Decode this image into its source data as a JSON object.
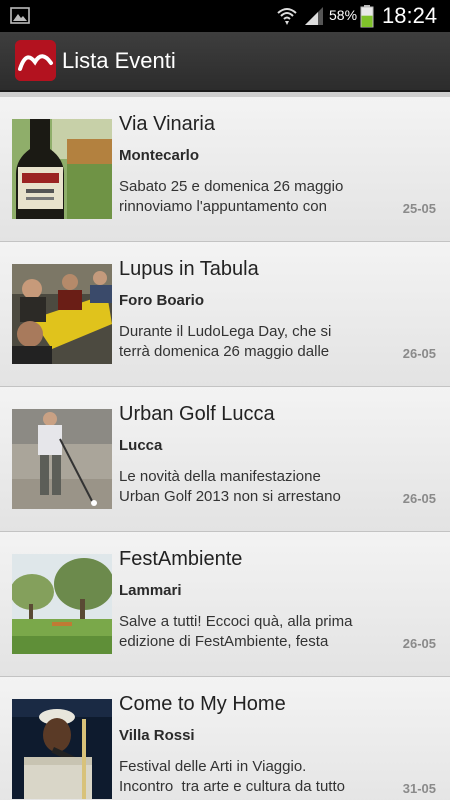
{
  "status_bar": {
    "battery_percent": "58%",
    "time": "18:24",
    "icons": [
      "gallery-icon",
      "wifi-icon",
      "signal-icon",
      "battery-icon"
    ],
    "battery_level": 0.58
  },
  "action_bar": {
    "title": "Lista Eventi",
    "logo_icon": "app-logo-icon",
    "logo_color": "#b3121f"
  },
  "events": [
    {
      "title": "Via Vinaria",
      "location": "Montecarlo",
      "description": "Sabato 25 e domenica 26 maggio\nrinnoviamo l'appuntamento con",
      "date": "25-05",
      "image": "wine-bottle-thumbnail"
    },
    {
      "title": "Lupus in Tabula",
      "location": "Foro Boario",
      "description": "Durante il LudoLega Day, che si\nterrà domenica 26 maggio dalle",
      "date": "26-05",
      "image": "board-game-players-thumbnail"
    },
    {
      "title": "Urban Golf Lucca",
      "location": "Lucca",
      "description": "Le novità della manifestazione\nUrban Golf 2013 non si arrestano",
      "date": "26-05",
      "image": "golfer-thumbnail"
    },
    {
      "title": "FestAmbiente",
      "location": "Lammari",
      "description": "Salve a tutti! Eccoci quà, alla prima\nedizione di FestAmbiente, festa",
      "date": "26-05",
      "image": "park-trees-thumbnail"
    },
    {
      "title": "Come to My Home",
      "location": "Villa Rossi",
      "description": "Festival delle Arti in Viaggio.\nIncontro  tra arte e cultura da tutto",
      "date": "31-05",
      "image": "musician-thumbnail"
    }
  ]
}
